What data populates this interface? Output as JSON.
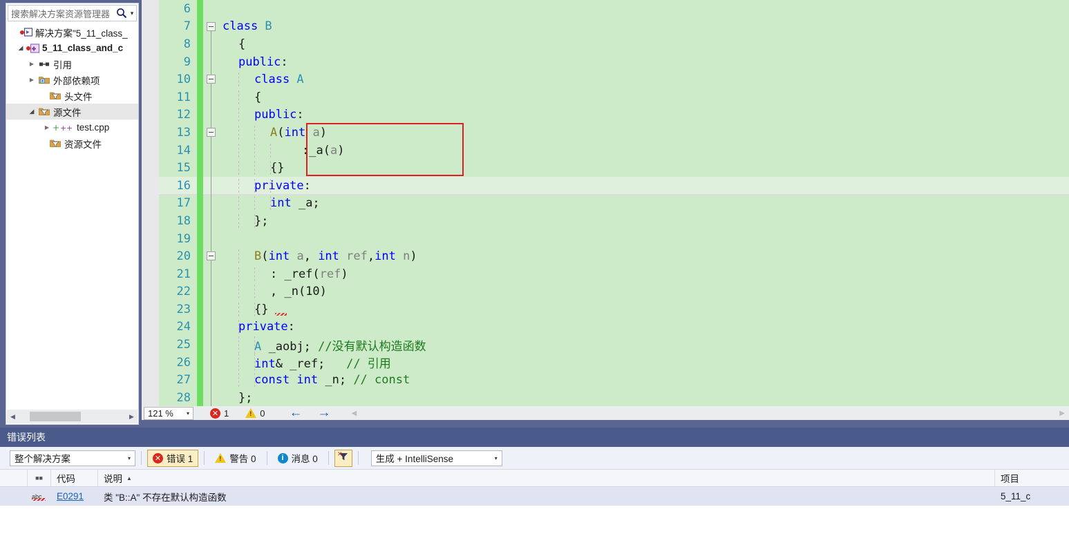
{
  "solution_explorer": {
    "search": {
      "placeholder": "搜索解决方案资源管理器",
      "magnifier_icon": "search-icon",
      "dropdown_icon": "chevron-down-icon"
    },
    "tree": [
      {
        "label": "解决方案\"5_11_class_",
        "icon": "solution-icon",
        "expander": "none",
        "indent": 0,
        "bold": false,
        "selected": false
      },
      {
        "label": "5_11_class_and_c",
        "icon": "project-icon",
        "expander": "down",
        "indent": 1,
        "bold": true,
        "selected": false
      },
      {
        "label": "引用",
        "icon": "references-icon",
        "expander": "right",
        "indent": 2,
        "bold": false,
        "selected": false
      },
      {
        "label": "外部依赖项",
        "icon": "external-deps-icon",
        "expander": "right",
        "indent": 2,
        "bold": false,
        "selected": false
      },
      {
        "label": "头文件",
        "icon": "filter-folder-icon",
        "expander": "none",
        "indent": 3,
        "bold": false,
        "selected": false
      },
      {
        "label": "源文件",
        "icon": "filter-folder-icon",
        "expander": "down",
        "indent": 2,
        "bold": false,
        "selected": true
      },
      {
        "label": "test.cpp",
        "icon": "cpp-file-icon",
        "expander": "right",
        "indent": 3,
        "bold": false,
        "selected": false
      },
      {
        "label": "资源文件",
        "icon": "filter-folder-icon",
        "expander": "none",
        "indent": 3,
        "bold": false,
        "selected": false
      }
    ],
    "hscroll": {
      "left_arrow": "triangle-left-icon",
      "right_arrow": "triangle-right-icon"
    }
  },
  "editor": {
    "lines": [
      {
        "num": "6",
        "indent": 0,
        "tokens": []
      },
      {
        "num": "7",
        "indent": 0,
        "tokens": [
          {
            "t": "class ",
            "c": "kw"
          },
          {
            "t": "B",
            "c": "typ"
          }
        ]
      },
      {
        "num": "8",
        "indent": 1,
        "tokens": [
          {
            "t": "{",
            "c": "pun"
          }
        ]
      },
      {
        "num": "9",
        "indent": 1,
        "tokens": [
          {
            "t": "public",
            "c": "kw"
          },
          {
            "t": ":",
            "c": "pun"
          }
        ]
      },
      {
        "num": "10",
        "indent": 2,
        "tokens": [
          {
            "t": "class ",
            "c": "kw"
          },
          {
            "t": "A",
            "c": "typ"
          }
        ]
      },
      {
        "num": "11",
        "indent": 2,
        "tokens": [
          {
            "t": "{",
            "c": "pun"
          }
        ]
      },
      {
        "num": "12",
        "indent": 2,
        "tokens": [
          {
            "t": "public",
            "c": "kw"
          },
          {
            "t": ":",
            "c": "pun"
          }
        ]
      },
      {
        "num": "13",
        "indent": 3,
        "tokens": [
          {
            "t": "A",
            "c": "fn"
          },
          {
            "t": "(",
            "c": "pun"
          },
          {
            "t": "int ",
            "c": "kw"
          },
          {
            "t": "a",
            "c": "par"
          },
          {
            "t": ")",
            "c": "pun"
          }
        ]
      },
      {
        "num": "14",
        "indent": 5,
        "tokens": [
          {
            "t": ":_a(",
            "c": "pun"
          },
          {
            "t": "a",
            "c": "par"
          },
          {
            "t": ")",
            "c": "pun"
          }
        ]
      },
      {
        "num": "15",
        "indent": 3,
        "tokens": [
          {
            "t": "{}",
            "c": "pun"
          }
        ]
      },
      {
        "num": "16",
        "indent": 2,
        "tokens": [
          {
            "t": "private",
            "c": "kw"
          },
          {
            "t": ":",
            "c": "pun"
          }
        ]
      },
      {
        "num": "17",
        "indent": 3,
        "tokens": [
          {
            "t": "int",
            "c": "kw"
          },
          {
            "t": " _a;",
            "c": "pun"
          }
        ]
      },
      {
        "num": "18",
        "indent": 2,
        "tokens": [
          {
            "t": "};",
            "c": "pun"
          }
        ]
      },
      {
        "num": "19",
        "indent": 0,
        "tokens": []
      },
      {
        "num": "20",
        "indent": 2,
        "tokens": [
          {
            "t": "B",
            "c": "fn"
          },
          {
            "t": "(",
            "c": "pun"
          },
          {
            "t": "int ",
            "c": "kw"
          },
          {
            "t": "a",
            "c": "par"
          },
          {
            "t": ", ",
            "c": "pun"
          },
          {
            "t": "int ",
            "c": "kw"
          },
          {
            "t": "ref",
            "c": "par"
          },
          {
            "t": ",",
            "c": "pun"
          },
          {
            "t": "int ",
            "c": "kw"
          },
          {
            "t": "n",
            "c": "par"
          },
          {
            "t": ")",
            "c": "pun"
          }
        ]
      },
      {
        "num": "21",
        "indent": 3,
        "tokens": [
          {
            "t": ": _ref(",
            "c": "pun"
          },
          {
            "t": "ref",
            "c": "par"
          },
          {
            "t": ")",
            "c": "pun"
          }
        ]
      },
      {
        "num": "22",
        "indent": 3,
        "tokens": [
          {
            "t": ", _n(10)",
            "c": "pun"
          }
        ]
      },
      {
        "num": "23",
        "indent": 2,
        "tokens": [
          {
            "t": "{}",
            "c": "pun"
          }
        ]
      },
      {
        "num": "24",
        "indent": 1,
        "tokens": [
          {
            "t": "private",
            "c": "kw"
          },
          {
            "t": ":",
            "c": "pun"
          }
        ]
      },
      {
        "num": "25",
        "indent": 2,
        "tokens": [
          {
            "t": "A",
            "c": "typ"
          },
          {
            "t": " _aobj; ",
            "c": "pun"
          },
          {
            "t": "//没有默认构造函数",
            "c": "cmt"
          }
        ]
      },
      {
        "num": "26",
        "indent": 2,
        "tokens": [
          {
            "t": "int",
            "c": "kw"
          },
          {
            "t": "& _ref;   ",
            "c": "pun"
          },
          {
            "t": "// 引用",
            "c": "cmt"
          }
        ]
      },
      {
        "num": "27",
        "indent": 2,
        "tokens": [
          {
            "t": "const int",
            "c": "kw"
          },
          {
            "t": " _n; ",
            "c": "pun"
          },
          {
            "t": "// const",
            "c": "cmt"
          }
        ]
      },
      {
        "num": "28",
        "indent": 1,
        "tokens": [
          {
            "t": "};",
            "c": "pun"
          }
        ]
      }
    ],
    "current_line": "16",
    "collapse_boxes": [
      "7",
      "10",
      "13",
      "20"
    ],
    "annotation_rect": {
      "from_line": "13",
      "to_line": "15",
      "color": "#e02020"
    },
    "status": {
      "zoom": "121 %",
      "zoom_caret_icon": "chevron-down-icon",
      "error_count": "1",
      "warning_count": "0",
      "error_icon": "error-circle-icon",
      "warning_icon": "warning-triangle-icon",
      "back_arrow": "arrow-left-icon",
      "forward_arrow": "arrow-right-icon",
      "hscroll_left_icon": "triangle-left-icon",
      "hscroll_right_icon": "triangle-right-icon"
    }
  },
  "error_list": {
    "title": "错误列表",
    "toolbar": {
      "scope": "整个解决方案",
      "scope_caret_icon": "chevron-down-icon",
      "errors_label": "错误 1",
      "warnings_label": "警告 0",
      "messages_label": "消息 0",
      "error_icon": "error-circle-icon",
      "warning_icon": "warning-triangle-icon",
      "message_icon": "info-circle-icon",
      "clear_filter_icon": "clear-filter-icon",
      "build_filter": "生成 + IntelliSense",
      "build_filter_caret_icon": "chevron-down-icon"
    },
    "columns": [
      {
        "key": "icon",
        "label": ""
      },
      {
        "key": "glyph",
        "label": ""
      },
      {
        "key": "code",
        "label": "代码"
      },
      {
        "key": "desc",
        "label": "说明",
        "sorted": "asc",
        "sort_icon": "sort-asc-icon"
      },
      {
        "key": "proj",
        "label": "项目"
      }
    ],
    "rows": [
      {
        "severity_icon": "intellisense-error-icon",
        "code": "E0291",
        "description": "类 \"B::A\" 不存在默认构造函数",
        "project": "5_11_c"
      }
    ]
  }
}
